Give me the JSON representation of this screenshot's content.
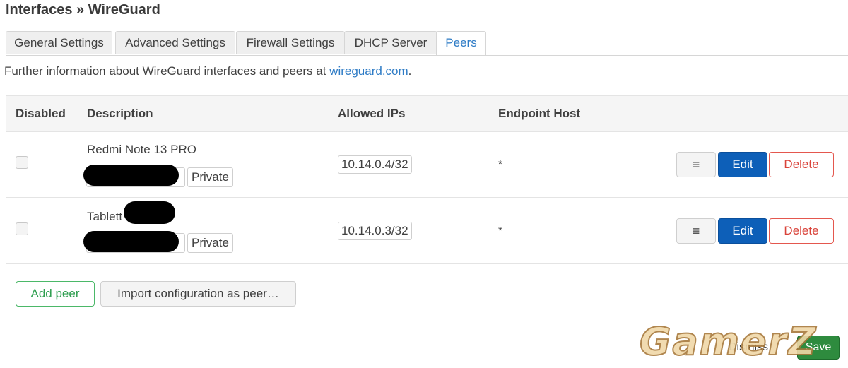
{
  "page": {
    "title": "Interfaces » WireGuard"
  },
  "tabs": [
    {
      "label": "General Settings"
    },
    {
      "label": "Advanced Settings"
    },
    {
      "label": "Firewall Settings"
    },
    {
      "label": "DHCP Server"
    },
    {
      "label": "Peers",
      "active": true
    }
  ],
  "info": {
    "text": "Further information about WireGuard interfaces and peers at ",
    "link": "wireguard.com",
    "suffix": "."
  },
  "table": {
    "headers": {
      "disabled": "Disabled",
      "description": "Description",
      "allowed_ips": "Allowed IPs",
      "endpoint_host": "Endpoint Host"
    },
    "rows": [
      {
        "description": "Redmi Note 13 PRO",
        "private_label": "Private",
        "allowed_ip": "10.14.0.4/32",
        "endpoint": "*",
        "edit": "Edit",
        "delete": "Delete",
        "menu_icon": "≡"
      },
      {
        "description": "Tablett",
        "private_label": "Private",
        "allowed_ip": "10.14.0.3/32",
        "endpoint": "*",
        "edit": "Edit",
        "delete": "Delete",
        "menu_icon": "≡"
      }
    ]
  },
  "actions": {
    "add_peer": "Add peer",
    "import": "Import configuration as peer…"
  },
  "footer": {
    "dismiss": "Dismiss",
    "save": "Save"
  },
  "watermark": "GamerZ",
  "colors": {
    "accent": "#2f7cc6",
    "edit": "#0d5fb8",
    "delete": "#d9433a",
    "add": "#2e9e4f"
  }
}
